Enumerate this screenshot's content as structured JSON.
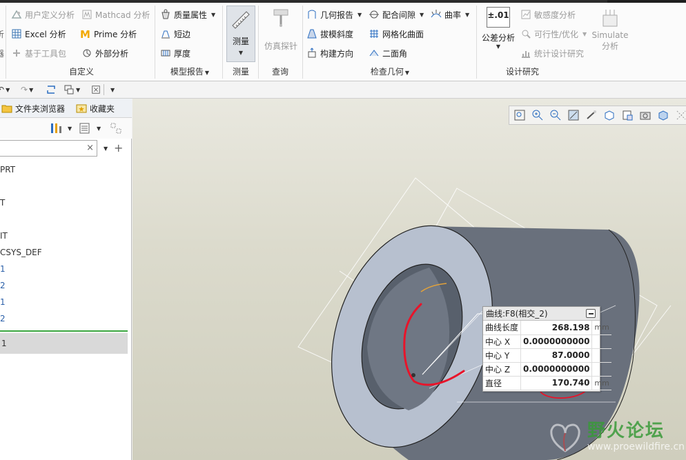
{
  "ribbon": {
    "customize_group": {
      "label": "自定义",
      "items": [
        "用户定义分析",
        "Mathcad 分析",
        "Excel 分析",
        "Prime 分析",
        "基于工具包",
        "外部分析"
      ]
    },
    "model_report_group": {
      "label": "模型报告",
      "items": [
        "质量属性",
        "短边",
        "厚度"
      ]
    },
    "measure_group": {
      "label": "测量",
      "button": "测量"
    },
    "query_group": {
      "label": "查询",
      "button": "仿真探针"
    },
    "inspect_geometry_group": {
      "label": "检查几何",
      "items": [
        "几何报告",
        "配合间隙",
        "曲率",
        "拔模斜度",
        "网格化曲面",
        "构建方向",
        "二面角"
      ]
    },
    "design_study_group": {
      "label": "设计研究",
      "tolerance_label": "公差分析",
      "tolerance_icon_text": "±.01",
      "items": [
        "敏感度分析",
        "可行性/优化",
        "统计设计研究"
      ],
      "simulate_label_1": "Simulate",
      "simulate_label_2": "分析"
    }
  },
  "left_panel": {
    "tabs": [
      "文件夹浏览器",
      "收藏夹"
    ],
    "search": {
      "value": "",
      "clear_icon": "×"
    },
    "tree": [
      {
        "text": "PRT",
        "blue": false
      },
      {
        "text": "T",
        "blue": false
      },
      {
        "text": "IT",
        "blue": false
      },
      {
        "text": "CSYS_DEF",
        "blue": false
      },
      {
        "text": "1",
        "blue": true
      },
      {
        "text": "2",
        "blue": true
      },
      {
        "text": "1",
        "blue": true
      },
      {
        "text": "2",
        "blue": true
      },
      {
        "text": "1",
        "blue": false
      }
    ]
  },
  "measure_panel": {
    "title": "曲线:F8(相交_2)",
    "rows": [
      {
        "key": "曲线长度",
        "value": "268.198",
        "unit": "mm"
      },
      {
        "key": "中心 X",
        "value": "0.0000000000",
        "unit": ""
      },
      {
        "key": "中心 Y",
        "value": "87.0000",
        "unit": ""
      },
      {
        "key": "中心 Z",
        "value": "0.0000000000",
        "unit": ""
      },
      {
        "key": "直径",
        "value": "170.740",
        "unit": "mm"
      }
    ]
  },
  "watermark": {
    "text": "野火论坛",
    "url_text": "www.proewildfire.cn"
  },
  "colors": {
    "annotation_red": "#e8142a",
    "model_fill": "#69707c",
    "model_face": "#b7c0cf"
  }
}
